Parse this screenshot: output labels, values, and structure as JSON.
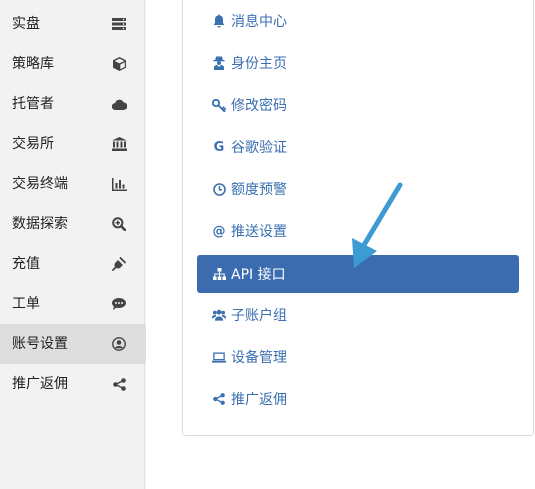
{
  "sidebar": {
    "items": [
      {
        "label": "实盘",
        "icon": "server-icon"
      },
      {
        "label": "策略库",
        "icon": "cube-icon"
      },
      {
        "label": "托管者",
        "icon": "cloud-icon"
      },
      {
        "label": "交易所",
        "icon": "bank-icon"
      },
      {
        "label": "交易终端",
        "icon": "bar-chart-icon"
      },
      {
        "label": "数据探索",
        "icon": "search-plus-icon"
      },
      {
        "label": "充值",
        "icon": "plug-icon"
      },
      {
        "label": "工单",
        "icon": "comment-icon"
      },
      {
        "label": "账号设置",
        "icon": "user-circle-icon"
      },
      {
        "label": "推广返佣",
        "icon": "share-icon"
      }
    ]
  },
  "menu": {
    "items": [
      {
        "label": "消息中心",
        "icon": "bell-icon"
      },
      {
        "label": "身份主页",
        "icon": "user-secret-icon"
      },
      {
        "label": "修改密码",
        "icon": "key-icon"
      },
      {
        "label": "谷歌验证",
        "icon": "google-icon"
      },
      {
        "label": "额度预警",
        "icon": "clock-icon"
      },
      {
        "label": "推送设置",
        "icon": "at-icon"
      },
      {
        "label": "API 接口",
        "icon": "sitemap-icon"
      },
      {
        "label": "子账户组",
        "icon": "users-icon"
      },
      {
        "label": "设备管理",
        "icon": "laptop-icon"
      },
      {
        "label": "推广返佣",
        "icon": "share-icon"
      }
    ]
  },
  "glyphs": {
    "google": "G",
    "at": "@"
  },
  "colors": {
    "accent": "#3b6caf",
    "link": "#3a6fb0",
    "arrow": "#3d9bd4"
  }
}
